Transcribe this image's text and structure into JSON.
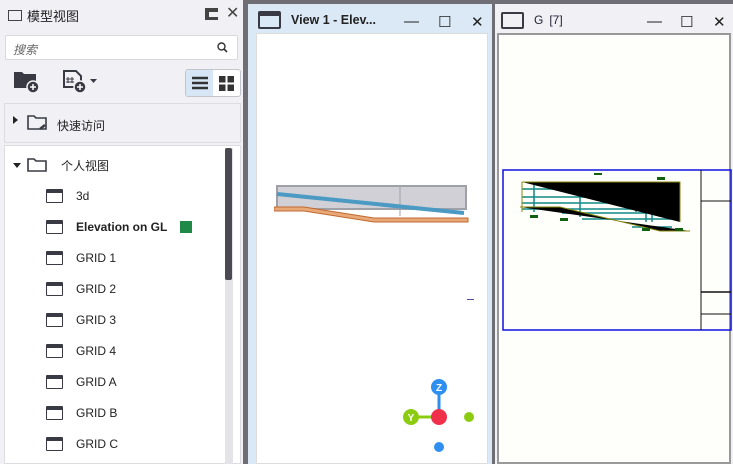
{
  "panel": {
    "title": "模型视图",
    "search_placeholder": "搜索"
  },
  "quick_access": {
    "label": "快速访问"
  },
  "personal": {
    "label": "个人视图",
    "items": [
      {
        "label": "3d"
      },
      {
        "label": "Elevation on GL",
        "active": true
      },
      {
        "label": "GRID 1"
      },
      {
        "label": "GRID 2"
      },
      {
        "label": "GRID 3"
      },
      {
        "label": "GRID 4"
      },
      {
        "label": "GRID A"
      },
      {
        "label": "GRID B"
      },
      {
        "label": "GRID C"
      }
    ]
  },
  "view1": {
    "title": "View 1 - Elev..."
  },
  "sheet": {
    "title": "G",
    "count": "[7]"
  },
  "gizmo": {
    "z": "Z",
    "y": "Y"
  },
  "colors": {
    "active_badge": "#1f8a48",
    "titlebar_active": "#dbe9f7"
  }
}
